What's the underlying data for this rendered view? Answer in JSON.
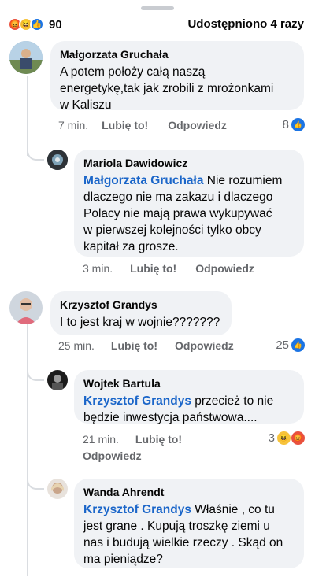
{
  "header": {
    "reaction_count": "90",
    "shares": "Udostępniono 4 razy",
    "reaction_icons": [
      "angry-icon",
      "haha-icon",
      "like-icon"
    ]
  },
  "comments": [
    {
      "author": "Małgorzata Gruchała",
      "text_lines": [
        "A potem położy całą naszą",
        "energetykę,tak jak zrobili z mrożonkami",
        "w Kaliszu"
      ],
      "time": "7 min.",
      "like": "Lubię to!",
      "reply": "Odpowiedz",
      "reactions": "8"
    },
    {
      "author": "Mariola Dawidowicz",
      "mention": "Małgorzata Gruchała",
      "text_first": " Nie rozumiem",
      "text_lines": [
        "dlaczego nie ma zakazu i dlaczego",
        "Polacy nie mają prawa wykupywać",
        "w pierwszej kolejności tylko obcy",
        "kapitał za grosze."
      ],
      "time": "3 min.",
      "like": "Lubię to!",
      "reply": "Odpowiedz"
    },
    {
      "author": "Krzysztof Grandys",
      "text_lines": [
        "I to jest kraj w wojnie???????"
      ],
      "time": "25 min.",
      "like": "Lubię to!",
      "reply": "Odpowiedz",
      "reactions": "25"
    },
    {
      "author": "Wojtek Bartula",
      "mention": "Krzysztof Grandys",
      "text_first": " przecież to nie",
      "text_lines": [
        "będzie inwestycja państwowa...."
      ],
      "time": "21 min.",
      "like": "Lubię to!",
      "reply": "Odpowiedz",
      "reactions": "3"
    },
    {
      "author": "Wanda Ahrendt",
      "mention": "Krzysztof Grandys",
      "text_first": "  Właśnie , co tu",
      "text_lines": [
        "jest grane . Kupują troszkę ziemi u",
        "nas i budują wielkie rzeczy . Skąd on",
        "ma pieniądze?"
      ]
    }
  ],
  "colors": {
    "accent": "#1b74e4",
    "mention": "#1b66c9",
    "bubble": "#f0f2f5",
    "meta": "#65676b"
  }
}
